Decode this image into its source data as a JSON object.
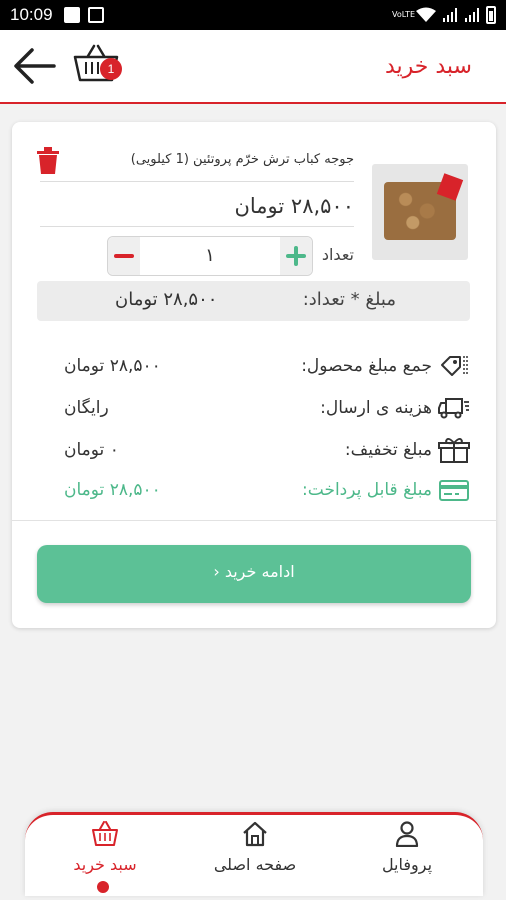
{
  "status_bar": {
    "time": "10:09",
    "network": "VoLTE"
  },
  "header": {
    "title": "سبد خرید",
    "cart_badge": "1"
  },
  "cart_item": {
    "name": "جوجه کباب ترش خرّم پروتئین (1 کیلویی)",
    "unit_price": "۲۸,۵۰۰ تومان",
    "quantity_label": "تعداد",
    "quantity": "۱",
    "subtotal_label": "مبلغ * تعداد:",
    "subtotal_value": "۲۸,۵۰۰ تومان"
  },
  "summary": {
    "product_total_label": "جمع مبلغ محصول:",
    "product_total_value": "۲۸,۵۰۰ تومان",
    "shipping_label": "هزینه ی ارسال:",
    "shipping_value": "رایگان",
    "discount_label": "مبلغ تخفیف:",
    "discount_value": "۰ تومان",
    "payable_label": "مبلغ قابل پرداخت:",
    "payable_value": "۲۸,۵۰۰ تومان"
  },
  "continue_button": "ادامه خرید",
  "bottom_nav": {
    "cart": "سبد خرید",
    "home": "صفحه اصلی",
    "profile": "پروفایل"
  },
  "colors": {
    "brand_red": "#d8232a",
    "accent_green": "#5cc196",
    "background": "#f2f2f2"
  }
}
